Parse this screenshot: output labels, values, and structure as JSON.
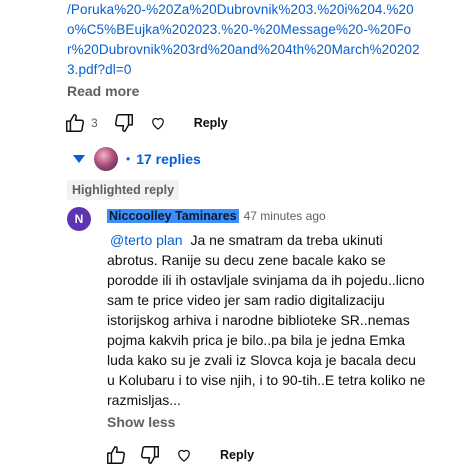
{
  "comment": {
    "link_text": "/Poruka%20-%20Za%20Dubrovnik%203.%20i%204.%20o%C5%BEujka%202023.%20-%20Message%20-%20For%20Dubrovnik%203rd%20and%204th%20March%202023.pdf?dl=0",
    "read_more_label": "Read more",
    "like_count": "3",
    "reply_label": "Reply"
  },
  "replies": {
    "count_label": "17 replies",
    "dot": "•"
  },
  "highlighted": {
    "badge": "Highlighted reply",
    "avatar_letter": "N",
    "author": "Niccoolley Taminares",
    "timestamp": "47 minutes ago",
    "mention": "@terto plan",
    "body": "Ja ne smatram da treba ukinuti abrotus. Ranije su decu zene bacale kako se porodde ili ih ostavljale svinjama da ih pojedu..licno sam te price video jer sam radio digitalizaciju istorijskog arhiva i narodne biblioteke SR..nemas pojma kakvih prica je bilo..pa bila je jedna Emka luda kako su je zvali iz Slovca koja je bacala decu u Kolubaru i to vise njih, i to 90-tih..E tetra koliko ne razmisljas...",
    "show_less_label": "Show less",
    "reply_label": "Reply"
  },
  "icons": {
    "like": "thumbs-up-icon",
    "dislike": "thumbs-down-icon",
    "heart": "heart-icon",
    "collapse": "caret-down-icon"
  },
  "colors": {
    "link": "#065fd4",
    "selection": "#3e8ef7",
    "avatar": "#5e35b1"
  }
}
